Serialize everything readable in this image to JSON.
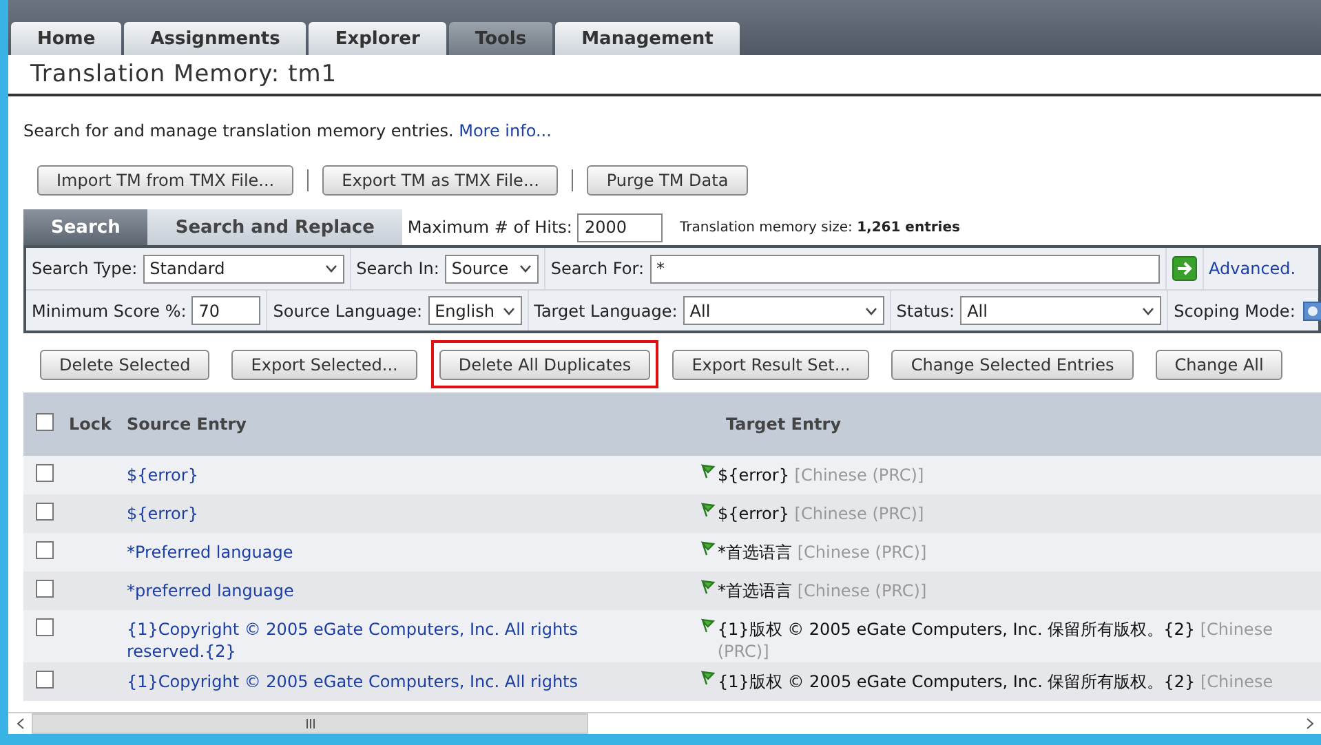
{
  "nav_tabs": [
    {
      "label": "Home",
      "selected": false
    },
    {
      "label": "Assignments",
      "selected": false
    },
    {
      "label": "Explorer",
      "selected": false
    },
    {
      "label": "Tools",
      "selected": true
    },
    {
      "label": "Management",
      "selected": false
    }
  ],
  "page_title": "Translation Memory: tm1",
  "description": {
    "text": "Search for and manage translation memory entries.",
    "link": "More info..."
  },
  "tm_buttons": [
    "Import TM from TMX File...",
    "Export TM as TMX File...",
    "Purge TM Data"
  ],
  "search_tabs": [
    {
      "label": "Search",
      "selected": true
    },
    {
      "label": "Search and Replace",
      "selected": false
    }
  ],
  "max_hits": {
    "label": "Maximum # of Hits:",
    "value": "2000"
  },
  "tm_size": {
    "label": "Translation memory size:",
    "value": "1,261 entries"
  },
  "filters_row1": [
    {
      "kind": "select",
      "label": "Search Type:",
      "value": "Standard"
    },
    {
      "kind": "select",
      "label": "Search In:",
      "value": "Source"
    },
    {
      "kind": "input",
      "label": "Search For:",
      "value": "*"
    },
    {
      "kind": "go"
    },
    {
      "kind": "link",
      "label": "Advanced."
    }
  ],
  "filters_row2": [
    {
      "kind": "input",
      "label": "Minimum Score %:",
      "value": "70"
    },
    {
      "kind": "select",
      "label": "Source Language:",
      "value": "English"
    },
    {
      "kind": "select",
      "label": "Target Language:",
      "value": "All"
    },
    {
      "kind": "select",
      "label": "Status:",
      "value": "All"
    },
    {
      "kind": "icon",
      "label": "Scoping Mode:"
    }
  ],
  "action_buttons": [
    {
      "label": "Delete Selected",
      "highlighted": false
    },
    {
      "label": "Export Selected...",
      "highlighted": false
    },
    {
      "label": "Delete All Duplicates",
      "highlighted": true
    },
    {
      "label": "Export Result Set...",
      "highlighted": false
    },
    {
      "label": "Change Selected Entries",
      "highlighted": false
    },
    {
      "label": "Change All",
      "highlighted": false
    }
  ],
  "table": {
    "select_all_checked": false,
    "columns": [
      "Lock",
      "Source Entry",
      "Target Entry"
    ],
    "rows": [
      {
        "checked": false,
        "source": "${error}",
        "target": "${error}",
        "language": "[Chinese (PRC)]"
      },
      {
        "checked": false,
        "source": "${error}",
        "target": "${error}",
        "language": "[Chinese (PRC)]"
      },
      {
        "checked": false,
        "source": "*Preferred language",
        "target": "*首选语言",
        "language": "[Chinese (PRC)]"
      },
      {
        "checked": false,
        "source": "*preferred language",
        "target": "*首选语言",
        "language": "[Chinese (PRC)]"
      },
      {
        "checked": false,
        "source": "{1}Copyright © 2005 eGate Computers, Inc. All rights reserved.{2}",
        "target": "{1}版权 © 2005 eGate Computers, Inc. 保留所有版权。{2}",
        "language": "[Chinese (PRC)]"
      },
      {
        "checked": false,
        "source": "{1}Copyright © 2005 eGate Computers, Inc. All rights",
        "target": "{1}版权 © 2005 eGate Computers, Inc. 保留所有版权。{2}",
        "language": "[Chinese"
      }
    ]
  }
}
